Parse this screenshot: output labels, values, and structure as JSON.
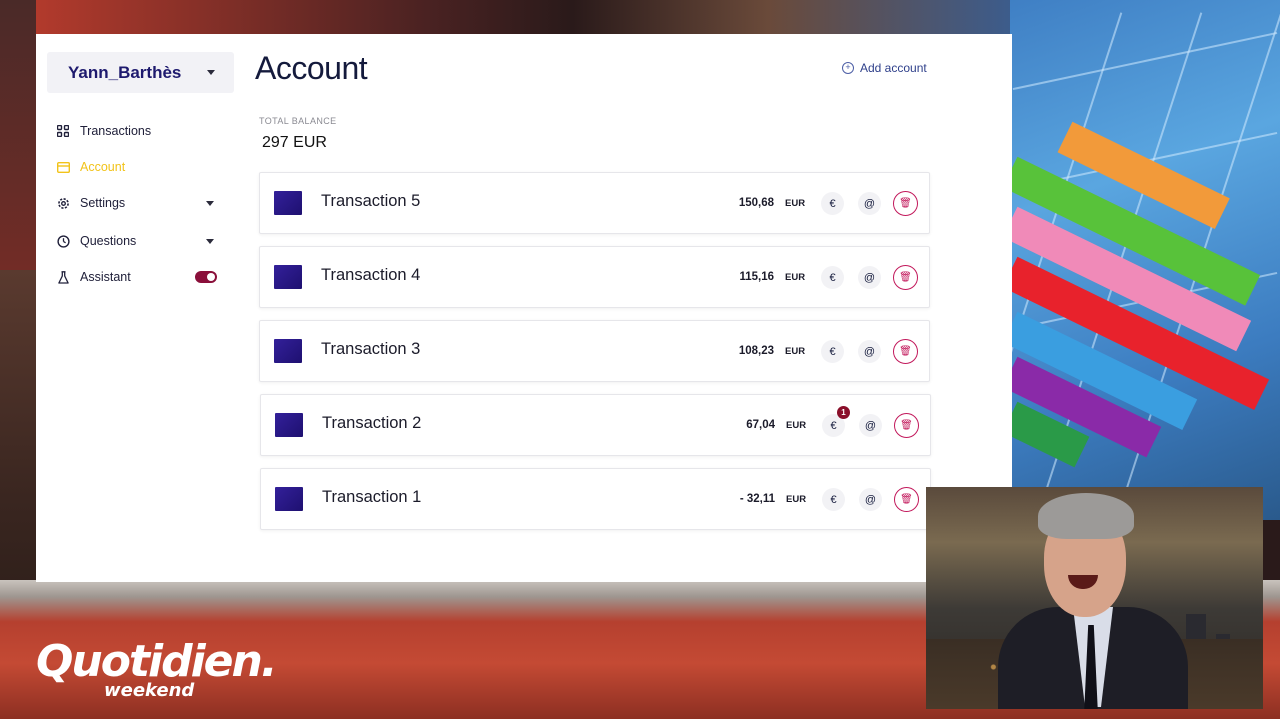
{
  "sidebar": {
    "user": "Yann_Barthès",
    "items": [
      {
        "label": "Transactions",
        "icon": "grid-icon",
        "active": false
      },
      {
        "label": "Account",
        "icon": "wallet-icon",
        "active": true
      },
      {
        "label": "Settings",
        "icon": "gear-icon",
        "active": false,
        "expandable": true
      },
      {
        "label": "Questions",
        "icon": "clock-icon",
        "active": false,
        "expandable": true
      },
      {
        "label": "Assistant",
        "icon": "flask-icon",
        "active": false,
        "toggle": true,
        "toggle_on": true
      }
    ]
  },
  "main": {
    "title": "Account",
    "add_account_label": "Add account",
    "balance_caption": "TOTAL BALANCE",
    "balance_value": "297 EUR",
    "transactions": [
      {
        "name": "Transaction 5",
        "amount": "150,68",
        "currency": "EUR",
        "badge": ""
      },
      {
        "name": "Transaction 4",
        "amount": "115,16",
        "currency": "EUR",
        "badge": ""
      },
      {
        "name": "Transaction 3",
        "amount": "108,23",
        "currency": "EUR",
        "badge": ""
      },
      {
        "name": "Transaction 2",
        "amount": "67,04",
        "currency": "EUR",
        "badge": "1"
      },
      {
        "name": "Transaction 1",
        "amount": "- 32,11",
        "currency": "EUR",
        "badge": ""
      }
    ]
  },
  "overlay": {
    "logo_main": "Quotidien.",
    "logo_sub": "weekend"
  },
  "colors": {
    "accent": "#f2c31a",
    "brand_dark": "#1e1a6e",
    "delete": "#c2185b",
    "toggle": "#8a0f3a",
    "thumb": "#2b1a8a"
  }
}
